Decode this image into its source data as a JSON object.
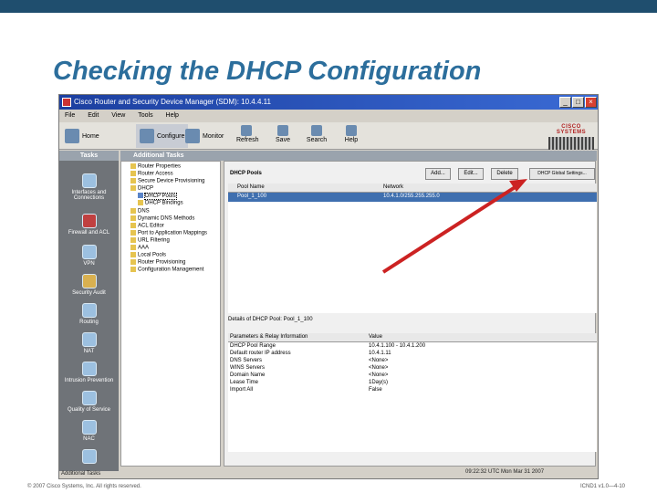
{
  "slide": {
    "title": "Checking the DHCP Configuration",
    "footer_left": "© 2007 Cisco Systems, Inc. All rights reserved.",
    "footer_right": "ICND1 v1.0—4-10"
  },
  "window": {
    "title": "Cisco Router and Security Device Manager (SDM): 10.4.4.11",
    "menus": [
      "File",
      "Edit",
      "View",
      "Tools",
      "Help"
    ],
    "toolbar": {
      "home": "Home",
      "configure": "Configure",
      "monitor": "Monitor",
      "refresh": "Refresh",
      "save": "Save",
      "search": "Search",
      "help": "Help"
    },
    "brand": "CISCO SYSTEMS"
  },
  "tasks": {
    "header": "Tasks",
    "items": [
      "Interfaces and Connections",
      "Firewall and ACL",
      "VPN",
      "Security Audit",
      "Routing",
      "NAT",
      "Intrusion Prevention",
      "Quality of Service",
      "NAC",
      ""
    ],
    "footer": "Additional Tasks"
  },
  "additional_tasks": {
    "header": "Additional Tasks",
    "tree": [
      "Router Properties",
      "Router Access",
      "Secure Device Provisioning",
      "DHCP",
      "DHCP Pools",
      "DHCP Bindings",
      "DNS",
      "Dynamic DNS Methods",
      "ACL Editor",
      "Port to Application Mappings",
      "URL Filtering",
      "AAA",
      "Local Pools",
      "Router Provisioning",
      "Configuration Management"
    ]
  },
  "dhcp_pools": {
    "title": "DHCP Pools",
    "buttons": {
      "add": "Add...",
      "edit": "Edit...",
      "delete": "Delete",
      "global": "DHCP Global Settings..."
    },
    "columns": [
      "Pool Name",
      "Network"
    ],
    "rows": [
      [
        "Pool_1_100",
        "10.4.1.0/255.255.255.0"
      ]
    ]
  },
  "details": {
    "title": "Details of DHCP Pool: Pool_1_100",
    "columns": [
      "Parameters & Relay Information",
      "Value"
    ],
    "rows": [
      [
        "DHCP Pool Range",
        "10.4.1.100 - 10.4.1.200"
      ],
      [
        "Default router IP address",
        "10.4.1.11"
      ],
      [
        "DNS Servers",
        "<None>"
      ],
      [
        "WINS Servers",
        "<None>"
      ],
      [
        "Domain Name",
        "<None>"
      ],
      [
        "Lease Time",
        "1Day(s)"
      ],
      [
        "Import All",
        "False"
      ]
    ]
  },
  "status": "09:22:32 UTC Mon Mar 31 2007",
  "colors": {
    "accent": "#2c6e9c",
    "arrow": "#cc2222",
    "selection": "#3f6faf"
  }
}
